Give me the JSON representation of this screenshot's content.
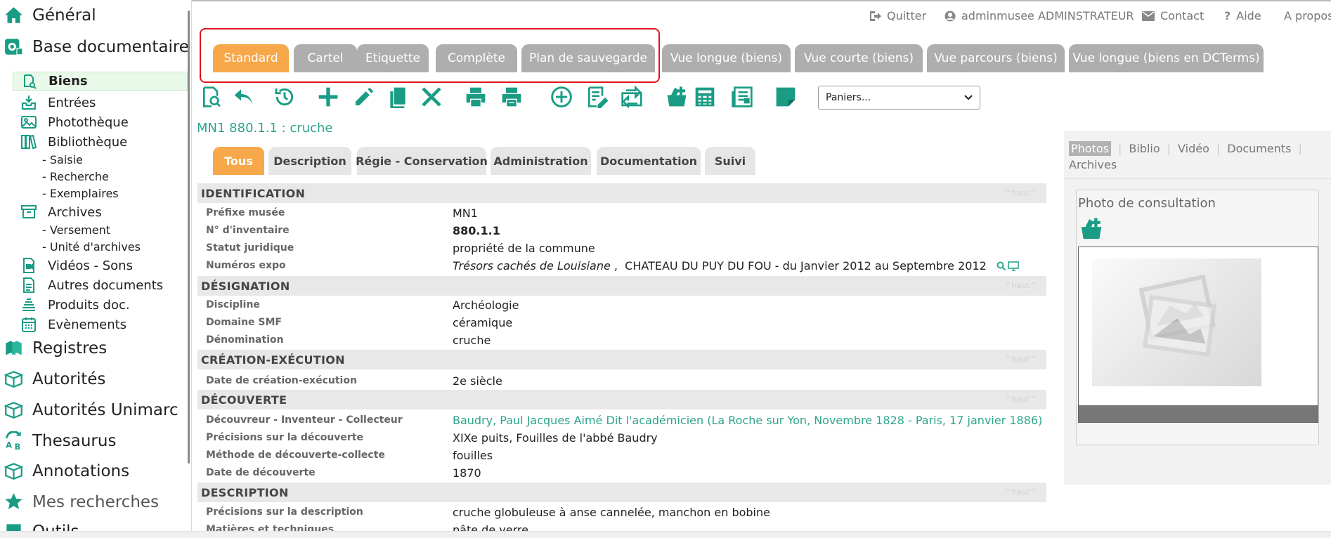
{
  "colors": {
    "accent_green": "#1a9c84",
    "tab_active": "#f6a84a",
    "tab_inactive": "#aeaeae",
    "link": "#2aa58c",
    "highlight": "#e1141c"
  },
  "sidebar": {
    "general": {
      "label": "Général",
      "icon": "home-icon"
    },
    "base": {
      "label": "Base documentaire",
      "icon": "database-icon"
    },
    "biens": {
      "label": "Biens",
      "icon": "object-search-icon"
    },
    "entrees": {
      "label": "Entrées",
      "icon": "inbox-download-icon"
    },
    "phototheque": {
      "label": "Photothèque",
      "icon": "images-icon"
    },
    "bibliotheque": {
      "label": "Bibliothèque",
      "icon": "books-icon"
    },
    "saisie": {
      "label": "- Saisie"
    },
    "recherche": {
      "label": "- Recherche"
    },
    "exemplaires": {
      "label": "- Exemplaires"
    },
    "archives": {
      "label": "Archives",
      "icon": "archive-box-icon"
    },
    "versement": {
      "label": "- Versement"
    },
    "unite": {
      "label": "- Unité d'archives"
    },
    "videos": {
      "label": "Vidéos - Sons",
      "icon": "video-file-icon"
    },
    "autres": {
      "label": "Autres documents",
      "icon": "document-icon"
    },
    "produits": {
      "label": "Produits doc.",
      "icon": "stack-icon"
    },
    "evenements": {
      "label": "Evènements",
      "icon": "calendar-icon"
    },
    "registres": {
      "label": "Registres",
      "icon": "registers-icon"
    },
    "autorites": {
      "label": "Autorités",
      "icon": "open-box-icon"
    },
    "unimarc": {
      "label": "Autorités Unimarc",
      "icon": "open-box-icon"
    },
    "thesaurus": {
      "label": "Thesaurus",
      "icon": "thesaurus-icon"
    },
    "annotations": {
      "label": "Annotations",
      "icon": "open-box-icon"
    },
    "mesrecherches": {
      "label": "Mes recherches",
      "icon": "star-icon"
    },
    "outils": {
      "label": "Outils",
      "icon": "tools-icon"
    }
  },
  "topbar": {
    "quitter": "Quitter",
    "user": "adminmusee ADMINSTRATEUR",
    "contact": "Contact",
    "aide": "Aide",
    "apropos": "A propos"
  },
  "view_tabs": [
    "Standard",
    "Cartel",
    "Etiquette",
    "Complète",
    "Plan de sauvegarde",
    "Vue longue (biens)",
    "Vue courte (biens)",
    "Vue parcours (biens)",
    "Vue longue (biens en DCTerms)"
  ],
  "toolbar": {
    "icons": [
      "search-record-icon",
      "back-icon",
      "history-icon",
      "add-icon",
      "edit-icon",
      "duplicate-icon",
      "delete-icon",
      "print-icon",
      "print-list-icon",
      "add-circle-icon",
      "form-edit-icon",
      "transfer-icon",
      "basket-add-icon",
      "calculator-icon",
      "report-icon",
      "note-icon"
    ],
    "paniers_select": "Paniers..."
  },
  "record": {
    "number": "MN1 880.1.1",
    "separator": " : ",
    "name": "cruche"
  },
  "detail_tabs": [
    "Tous",
    "Description",
    "Régie - Conservation",
    "Administration",
    "Documentation",
    "Suivi"
  ],
  "sections": {
    "identification": {
      "title": "IDENTIFICATION",
      "haut": "^haut^"
    },
    "designation": {
      "title": "DÉSIGNATION",
      "haut": "^haut^"
    },
    "creation": {
      "title": "CRÉATION-EXÉCUTION",
      "haut": "^haut^"
    },
    "decouverte": {
      "title": "DÉCOUVERTE",
      "haut": "^haut^"
    },
    "description": {
      "title": "DESCRIPTION",
      "haut": "^haut^"
    }
  },
  "fields": {
    "prefixe": {
      "label": "Préfixe musée",
      "value": "MN1"
    },
    "inventaire": {
      "label": "N° d'inventaire",
      "value": "880.1.1"
    },
    "statut": {
      "label": "Statut juridique",
      "value": "propriété de la commune"
    },
    "expo": {
      "label": "Numéros expo",
      "value_title": "Trésors cachés de Louisiane",
      "value_rest": " ,  CHATEAU DU PUY DU FOU - du Janvier 2012 au Septembre 2012"
    },
    "discipline": {
      "label": "Discipline",
      "value": "Archéologie"
    },
    "domaine": {
      "label": "Domaine SMF",
      "value": "céramique"
    },
    "denomination": {
      "label": "Dénomination",
      "value": "cruche"
    },
    "date_creation": {
      "label": "Date de création-exécution",
      "value": "2e siècle"
    },
    "decouvreur": {
      "label": "Découvreur - Inventeur - Collecteur",
      "value": "Baudry, Paul Jacques Aimé Dit l'académicien (La Roche sur Yon, Novembre 1828 - Paris, 17 janvier 1886)"
    },
    "precisions_dec": {
      "label": "Précisions sur la découverte",
      "value": "XIXe puits, Fouilles de l'abbé Baudry"
    },
    "methode": {
      "label": "Méthode de découverte-collecte",
      "value": "fouilles"
    },
    "date_dec": {
      "label": "Date de découverte",
      "value": "1870"
    },
    "precisions_desc": {
      "label": "Précisions sur la description",
      "value": "cruche globuleuse à anse cannelée, manchon en bobine"
    },
    "matieres": {
      "label": "Matières et techniques",
      "value": "pâte de verre"
    }
  },
  "right_panel": {
    "media_tabs": [
      "Photos",
      "Biblio",
      "Vidéo",
      "Documents",
      "Archives"
    ],
    "photo_title": "Photo de consultation"
  }
}
